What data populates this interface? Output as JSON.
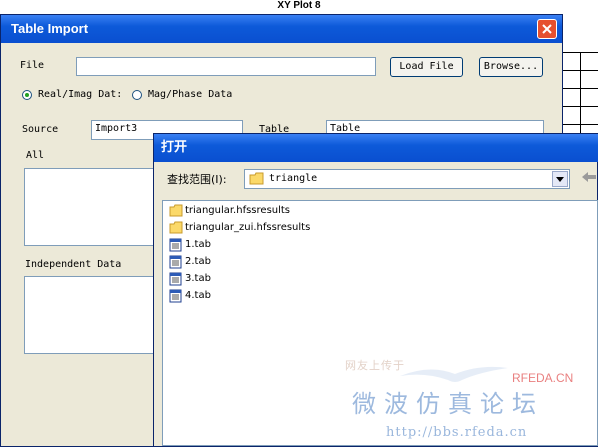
{
  "background": {
    "plot_title": "XY Plot 8"
  },
  "table_import": {
    "title": "Table Import",
    "file_label": "File",
    "file_value": "",
    "load_file_button": "Load File",
    "browse_button": "Browse...",
    "radio_real_imag": "Real/Imag Dat:",
    "radio_mag_phase": "Mag/Phase Data",
    "selected_radio": "Real/Imag Dat:",
    "source_label": "Source",
    "source_value": "Import3",
    "table_label": "Table",
    "table_value": "Table",
    "all_label": "All",
    "independent_label": "Independent Data"
  },
  "open_dialog": {
    "title": "打开",
    "lookin_label": "查找范围(I):",
    "lookin_value": "triangle",
    "items": [
      {
        "name": "triangular.hfssresults",
        "icon": "folder-icon"
      },
      {
        "name": "triangular_zui.hfssresults",
        "icon": "folder-icon"
      },
      {
        "name": "1.tab",
        "icon": "tab-file-icon"
      },
      {
        "name": "2.tab",
        "icon": "tab-file-icon"
      },
      {
        "name": "3.tab",
        "icon": "tab-file-icon"
      },
      {
        "name": "4.tab",
        "icon": "tab-file-icon"
      }
    ]
  },
  "watermark": {
    "cn_small": "网友上传于",
    "brand": "RFEDA.CN",
    "cn_big": "微波仿真论坛",
    "url": "http://bbs.rfeda.cn"
  },
  "colors": {
    "titlebar": "#0d5ad9",
    "dialog_bg": "#ece9d8",
    "close_button": "#e6502f",
    "watermark_blue": "#9db9de"
  }
}
